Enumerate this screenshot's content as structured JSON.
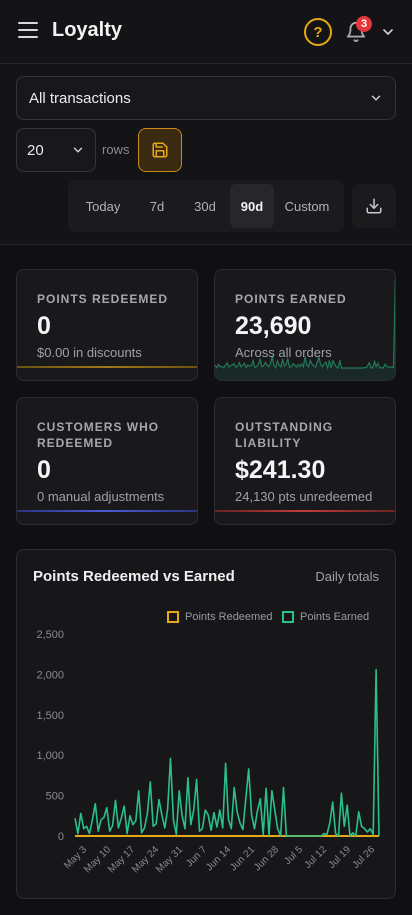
{
  "header": {
    "title": "Loyalty",
    "notification_count": "3",
    "icons": [
      "menu-icon",
      "help-icon",
      "bell-icon",
      "chevron-down-icon"
    ]
  },
  "filters": {
    "transaction_filter": "All transactions",
    "rows_value": "20",
    "rows_label": "rows",
    "ranges": [
      "Today",
      "7d",
      "30d",
      "90d",
      "Custom"
    ],
    "active_range": "90d"
  },
  "cards": {
    "points_redeemed": {
      "label": "POINTS REDEEMED",
      "value": "0",
      "sub": "$0.00 in discounts",
      "accent": "#e6a817"
    },
    "points_earned": {
      "label": "POINTS EARNED",
      "value": "23,690",
      "sub": "Across all orders",
      "accent": "#2bbf8a"
    },
    "customers_redeemed": {
      "label": "CUSTOMERS WHO REDEEMED",
      "value": "0",
      "sub": "0 manual adjustments",
      "accent": "#4a5ad6"
    },
    "outstanding": {
      "label": "OUTSTANDING LIABILITY",
      "value": "$241.30",
      "sub": "24,130 pts unredeemed",
      "accent": "#c43a3a"
    }
  },
  "chart": {
    "title": "Points Redeemed vs Earned",
    "subtitle": "Daily totals"
  },
  "chart_data": {
    "type": "line",
    "ylim": [
      0,
      2500
    ],
    "yticks": [
      0,
      500,
      1000,
      1500,
      2000,
      2500
    ],
    "xticks": [
      "May 3",
      "May 10",
      "May 17",
      "May 24",
      "May 31",
      "Jun 7",
      "Jun 14",
      "Jun 21",
      "Jun 28",
      "Jul 5",
      "Jul 12",
      "Jul 19",
      "Jul 26"
    ],
    "series": [
      {
        "name": "Points Redeemed",
        "color": "#e6a817",
        "values": [
          0,
          0,
          0,
          0,
          0,
          0,
          0,
          0,
          0,
          0,
          0,
          0,
          0,
          0,
          0,
          0,
          0,
          0,
          0,
          0,
          0,
          0,
          0,
          0,
          0,
          0,
          0,
          0,
          0,
          0,
          0,
          0,
          0,
          0,
          0,
          0,
          0,
          0,
          0,
          0,
          0,
          0,
          0,
          0,
          0,
          0,
          0,
          0,
          0,
          0,
          0,
          0,
          0,
          0,
          0,
          0,
          0,
          0,
          0,
          0,
          0,
          0,
          0,
          0,
          0,
          0,
          0,
          0,
          0,
          0,
          0,
          0,
          0,
          0,
          0,
          0,
          0,
          0,
          0,
          0,
          0,
          0,
          0,
          0,
          0,
          0,
          0,
          0,
          0,
          0,
          0
        ]
      },
      {
        "name": "Points Earned",
        "color": "#2bbf8a",
        "values": [
          220,
          30,
          280,
          90,
          120,
          30,
          200,
          400,
          60,
          200,
          230,
          350,
          60,
          130,
          440,
          100,
          220,
          370,
          30,
          250,
          140,
          190,
          560,
          40,
          100,
          280,
          670,
          120,
          150,
          450,
          260,
          100,
          330,
          960,
          200,
          20,
          560,
          250,
          90,
          720,
          140,
          320,
          700,
          60,
          90,
          320,
          260,
          70,
          290,
          110,
          320,
          100,
          900,
          210,
          90,
          600,
          300,
          160,
          80,
          460,
          830,
          260,
          90,
          310,
          460,
          20,
          590,
          10,
          560,
          320,
          90,
          0,
          600,
          0,
          0,
          0,
          0,
          0,
          0,
          0,
          0,
          0,
          0,
          0,
          0,
          0,
          30,
          20,
          160,
          420,
          30,
          0,
          530,
          120,
          380,
          0,
          40,
          0,
          300,
          120,
          90,
          50,
          90,
          20,
          2060,
          0
        ]
      }
    ]
  }
}
